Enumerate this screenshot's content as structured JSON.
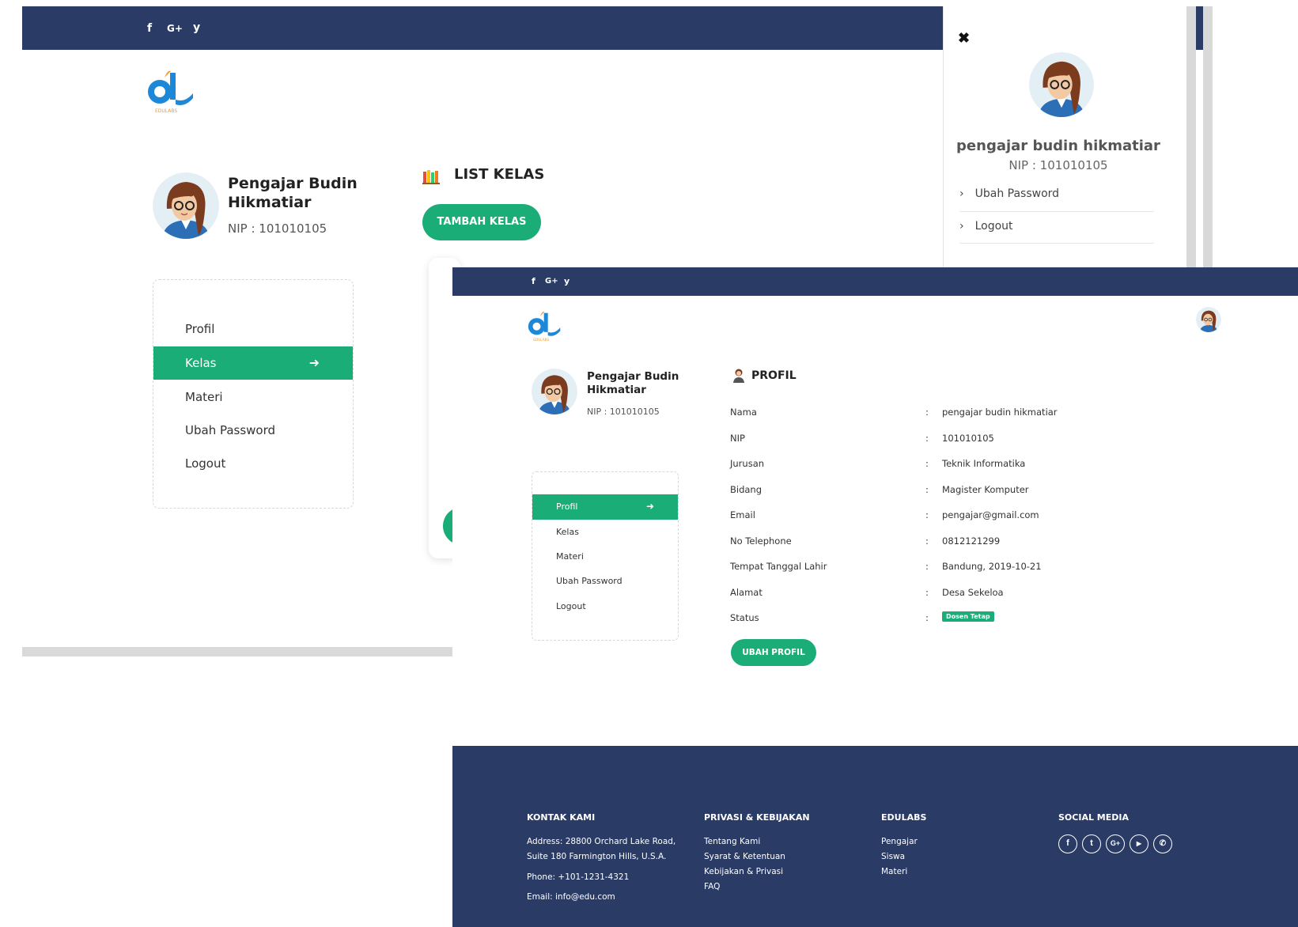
{
  "back": {
    "social": [
      "f",
      "G+",
      "y"
    ],
    "logo_text": "EDULABS",
    "profile": {
      "name": "Pengajar Budin Hikmatiar",
      "nip": "NIP : 101010105"
    },
    "menu": [
      {
        "label": "Profil",
        "active": false
      },
      {
        "label": "Kelas",
        "active": true
      },
      {
        "label": "Materi",
        "active": false
      },
      {
        "label": "Ubah Password",
        "active": false
      },
      {
        "label": "Logout",
        "active": false
      }
    ],
    "section_title": "LIST KELAS",
    "add_button": "TAMBAH KELAS"
  },
  "side_panel": {
    "close": "✖",
    "name": "pengajar budin hikmatiar",
    "nip": "NIP : 101010105",
    "items": [
      "Ubah Password",
      "Logout"
    ]
  },
  "front": {
    "social": [
      "f",
      "G+",
      "y"
    ],
    "logo_text": "EDULABS",
    "profile": {
      "name": "Pengajar Budin Hikmatiar",
      "nip": "NIP : 101010105"
    },
    "menu": [
      {
        "label": "Profil",
        "active": true
      },
      {
        "label": "Kelas",
        "active": false
      },
      {
        "label": "Materi",
        "active": false
      },
      {
        "label": "Ubah Password",
        "active": false
      },
      {
        "label": "Logout",
        "active": false
      }
    ],
    "section_title": "PROFIL",
    "fields": [
      {
        "label": "Nama",
        "value": "pengajar budin hikmatiar"
      },
      {
        "label": "NIP",
        "value": "101010105"
      },
      {
        "label": "Jurusan",
        "value": "Teknik Informatika"
      },
      {
        "label": "Bidang",
        "value": "Magister Komputer"
      },
      {
        "label": "Email",
        "value": "pengajar@gmail.com"
      },
      {
        "label": "No Telephone",
        "value": "0812121299"
      },
      {
        "label": "Tempat Tanggal Lahir",
        "value": "Bandung, 2019-10-21"
      },
      {
        "label": "Alamat",
        "value": "Desa Sekeloa"
      },
      {
        "label": "Status",
        "value": "Dosen Tetap"
      }
    ],
    "edit_button": "UBAH PROFIL",
    "footer": {
      "contact_title": "KONTAK KAMI",
      "address": "Address: 28800 Orchard Lake Road, Suite 180 Farmington Hills, U.S.A.",
      "phone": "Phone: +101-1231-4321",
      "email": "Email: info@edu.com",
      "privacy_title": "PRIVASI & KEBIJAKAN",
      "privacy_links": [
        "Tentang Kami",
        "Syarat & Ketentuan",
        "Kebijakan & Privasi",
        "FAQ"
      ],
      "edulabs_title": "EDULABS",
      "edulabs_links": [
        "Pengajar",
        "Siswa",
        "Materi"
      ],
      "social_title": "SOCIAL MEDIA",
      "social_icons": [
        "f",
        "t",
        "G+",
        "yt",
        "wa"
      ]
    }
  },
  "colors": {
    "navy": "#2a3b66",
    "green": "#1aad78"
  }
}
